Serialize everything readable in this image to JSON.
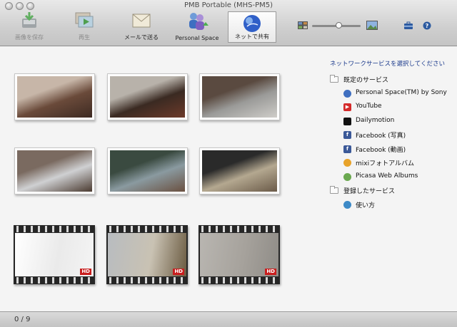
{
  "window": {
    "title": "PMB Portable (MHS-PM5)"
  },
  "toolbar": {
    "items": [
      {
        "label": "画像を保存",
        "icon": "save-image-icon",
        "state": "disabled"
      },
      {
        "label": "再生",
        "icon": "play-slideshow-icon",
        "state": "disabled"
      },
      {
        "label": "メールで送る",
        "icon": "mail-envelope-icon",
        "state": "normal"
      },
      {
        "label": "Personal Space",
        "icon": "personal-space-icon",
        "state": "normal"
      },
      {
        "label": "ネットで共有",
        "icon": "globe-share-icon",
        "state": "selected"
      }
    ]
  },
  "thumbnails": [
    {
      "type": "photo",
      "palette": [
        "#6a4a3a",
        "#c7b6a8",
        "#3d2a22"
      ]
    },
    {
      "type": "photo",
      "palette": [
        "#3a2a22",
        "#b8b2aa",
        "#6d3a2a"
      ]
    },
    {
      "type": "photo",
      "palette": [
        "#9a9a98",
        "#5a4a40",
        "#cfcdc9"
      ]
    },
    {
      "type": "photo",
      "palette": [
        "#cfd0d2",
        "#7a6a60",
        "#4a3a30"
      ]
    },
    {
      "type": "photo",
      "palette": [
        "#8a9aa0",
        "#3a4a40",
        "#6a5040"
      ]
    },
    {
      "type": "photo",
      "palette": [
        "#b4a890",
        "#2a2a2a",
        "#6a5a48"
      ]
    },
    {
      "type": "video",
      "badge": "HD",
      "palette": [
        "#ffffff",
        "#f4f4f4",
        "#eaeaea"
      ]
    },
    {
      "type": "video",
      "badge": "HD",
      "palette": [
        "#b8bcc0",
        "#6a5a40",
        "#c9c2b3"
      ]
    },
    {
      "type": "video",
      "badge": "HD",
      "palette": [
        "#b9b6b1",
        "#8f8c87",
        "#a6a29c"
      ]
    }
  ],
  "services": {
    "header": "ネットワークサービスを選択してください",
    "sections": [
      {
        "name": "既定のサービス",
        "icon": "folder-icon",
        "items": [
          {
            "label": "Personal Space(TM) by Sony",
            "icon": "personal-space-icon",
            "color": "#3f6fc0"
          },
          {
            "label": "YouTube",
            "icon": "youtube-icon",
            "color": "#d42a2a"
          },
          {
            "label": "Dailymotion",
            "icon": "dailymotion-icon",
            "color": "#111111"
          },
          {
            "label": "Facebook (写真)",
            "icon": "facebook-icon",
            "color": "#3b5998"
          },
          {
            "label": "Facebook (動画)",
            "icon": "facebook-icon",
            "color": "#3b5998"
          },
          {
            "label": "mixiフォトアルバム",
            "icon": "mixi-icon",
            "color": "#e8a32a"
          },
          {
            "label": "Picasa Web Albums",
            "icon": "picasa-icon",
            "color": "#6aa84f"
          }
        ]
      },
      {
        "name": "登録したサービス",
        "icon": "folder-icon",
        "items": [
          {
            "label": "使い方",
            "icon": "help-globe-icon",
            "color": "#3d8ac7"
          }
        ]
      }
    ]
  },
  "status": {
    "count": "0 / 9"
  }
}
